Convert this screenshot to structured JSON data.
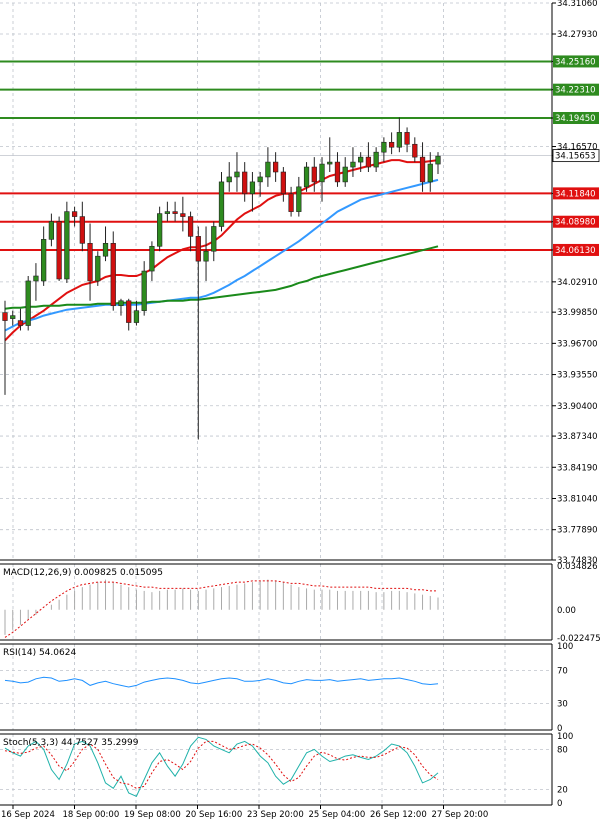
{
  "chart_data": {
    "type": "candlestick",
    "instrument_note": "",
    "y_axis_ticks": [
      "34.31060",
      "34.27930",
      "34.25160",
      "34.22310",
      "34.19450",
      "34.16570",
      "34.15653",
      "34.11840",
      "34.08980",
      "34.06130",
      "34.02910",
      "33.99850",
      "33.96700",
      "33.93550",
      "33.90400",
      "33.87340",
      "33.84190",
      "33.81040",
      "33.77890",
      "33.74830"
    ],
    "ylim": [
      33.7483,
      34.3106
    ],
    "current_price": "34.15653",
    "x_axis_labels": [
      "16 Sep 2024",
      "18 Sep 00:00",
      "19 Sep 08:00",
      "20 Sep 16:00",
      "23 Sep 20:00",
      "25 Sep 04:00",
      "26 Sep 12:00",
      "27 Sep 20:00"
    ],
    "levels": [
      {
        "value": 34.2516,
        "label": "34.25160",
        "color": "#2e8b1f"
      },
      {
        "value": 34.2231,
        "label": "34.22310",
        "color": "#2e8b1f"
      },
      {
        "value": 34.1945,
        "label": "34.19450",
        "color": "#2e8b1f"
      },
      {
        "value": 34.1184,
        "label": "34.11840",
        "color": "#e01010"
      },
      {
        "value": 34.0898,
        "label": "34.08980",
        "color": "#e01010"
      },
      {
        "value": 34.0613,
        "label": "34.06130",
        "color": "#e01010"
      }
    ],
    "candles": [
      {
        "o": 33.998,
        "h": 34.01,
        "l": 33.915,
        "c": 33.99
      },
      {
        "o": 33.992,
        "h": 34.0,
        "l": 33.985,
        "c": 33.995
      },
      {
        "o": 33.99,
        "h": 34.002,
        "l": 33.98,
        "c": 33.985
      },
      {
        "o": 33.985,
        "h": 34.035,
        "l": 33.98,
        "c": 34.03
      },
      {
        "o": 34.03,
        "h": 34.048,
        "l": 34.01,
        "c": 34.035
      },
      {
        "o": 34.03,
        "h": 34.085,
        "l": 34.025,
        "c": 34.072
      },
      {
        "o": 34.072,
        "h": 34.098,
        "l": 34.065,
        "c": 34.09
      },
      {
        "o": 34.09,
        "h": 34.095,
        "l": 34.03,
        "c": 34.032
      },
      {
        "o": 34.032,
        "h": 34.11,
        "l": 34.028,
        "c": 34.1
      },
      {
        "o": 34.1,
        "h": 34.105,
        "l": 34.085,
        "c": 34.095
      },
      {
        "o": 34.095,
        "h": 34.11,
        "l": 34.06,
        "c": 34.068
      },
      {
        "o": 34.068,
        "h": 34.088,
        "l": 34.01,
        "c": 34.03
      },
      {
        "o": 34.03,
        "h": 34.06,
        "l": 34.025,
        "c": 34.055
      },
      {
        "o": 34.055,
        "h": 34.085,
        "l": 34.05,
        "c": 34.068
      },
      {
        "o": 34.068,
        "h": 34.08,
        "l": 34.0,
        "c": 34.005
      },
      {
        "o": 34.005,
        "h": 34.012,
        "l": 33.995,
        "c": 34.01
      },
      {
        "o": 34.01,
        "h": 34.012,
        "l": 33.98,
        "c": 33.988
      },
      {
        "o": 33.988,
        "h": 34.01,
        "l": 33.985,
        "c": 34.0
      },
      {
        "o": 34.0,
        "h": 34.05,
        "l": 33.995,
        "c": 34.04
      },
      {
        "o": 34.04,
        "h": 34.07,
        "l": 34.03,
        "c": 34.065
      },
      {
        "o": 34.065,
        "h": 34.105,
        "l": 34.06,
        "c": 34.098
      },
      {
        "o": 34.098,
        "h": 34.11,
        "l": 34.09,
        "c": 34.1
      },
      {
        "o": 34.1,
        "h": 34.11,
        "l": 34.09,
        "c": 34.098
      },
      {
        "o": 34.098,
        "h": 34.115,
        "l": 34.08,
        "c": 34.095
      },
      {
        "o": 34.095,
        "h": 34.1,
        "l": 34.06,
        "c": 34.075
      },
      {
        "o": 34.075,
        "h": 34.085,
        "l": 33.87,
        "c": 34.05
      },
      {
        "o": 34.05,
        "h": 34.085,
        "l": 34.03,
        "c": 34.06
      },
      {
        "o": 34.06,
        "h": 34.09,
        "l": 34.05,
        "c": 34.085
      },
      {
        "o": 34.085,
        "h": 34.14,
        "l": 34.08,
        "c": 34.13
      },
      {
        "o": 34.13,
        "h": 34.15,
        "l": 34.12,
        "c": 34.135
      },
      {
        "o": 34.135,
        "h": 34.16,
        "l": 34.12,
        "c": 34.14
      },
      {
        "o": 34.14,
        "h": 34.15,
        "l": 34.11,
        "c": 34.118
      },
      {
        "o": 34.118,
        "h": 34.14,
        "l": 34.1,
        "c": 34.13
      },
      {
        "o": 34.13,
        "h": 34.14,
        "l": 34.115,
        "c": 34.135
      },
      {
        "o": 34.135,
        "h": 34.165,
        "l": 34.125,
        "c": 34.15
      },
      {
        "o": 34.15,
        "h": 34.16,
        "l": 34.13,
        "c": 34.14
      },
      {
        "o": 34.14,
        "h": 34.145,
        "l": 34.11,
        "c": 34.118
      },
      {
        "o": 34.118,
        "h": 34.125,
        "l": 34.095,
        "c": 34.1
      },
      {
        "o": 34.1,
        "h": 34.135,
        "l": 34.095,
        "c": 34.125
      },
      {
        "o": 34.125,
        "h": 34.15,
        "l": 34.12,
        "c": 34.145
      },
      {
        "o": 34.145,
        "h": 34.155,
        "l": 34.12,
        "c": 34.13
      },
      {
        "o": 34.13,
        "h": 34.155,
        "l": 34.11,
        "c": 34.148
      },
      {
        "o": 34.148,
        "h": 34.175,
        "l": 34.14,
        "c": 34.15
      },
      {
        "o": 34.15,
        "h": 34.16,
        "l": 34.125,
        "c": 34.13
      },
      {
        "o": 34.13,
        "h": 34.155,
        "l": 34.125,
        "c": 34.145
      },
      {
        "o": 34.145,
        "h": 34.165,
        "l": 34.135,
        "c": 34.15
      },
      {
        "o": 34.15,
        "h": 34.16,
        "l": 34.14,
        "c": 34.155
      },
      {
        "o": 34.155,
        "h": 34.17,
        "l": 34.14,
        "c": 34.145
      },
      {
        "o": 34.145,
        "h": 34.165,
        "l": 34.14,
        "c": 34.16
      },
      {
        "o": 34.16,
        "h": 34.175,
        "l": 34.15,
        "c": 34.17
      },
      {
        "o": 34.17,
        "h": 34.18,
        "l": 34.158,
        "c": 34.165
      },
      {
        "o": 34.165,
        "h": 34.195,
        "l": 34.16,
        "c": 34.18
      },
      {
        "o": 34.18,
        "h": 34.185,
        "l": 34.16,
        "c": 34.168
      },
      {
        "o": 34.168,
        "h": 34.175,
        "l": 34.15,
        "c": 34.155
      },
      {
        "o": 34.155,
        "h": 34.17,
        "l": 34.12,
        "c": 34.13
      },
      {
        "o": 34.13,
        "h": 34.16,
        "l": 34.12,
        "c": 34.148
      },
      {
        "o": 34.148,
        "h": 34.16,
        "l": 34.138,
        "c": 34.156
      }
    ],
    "moving_averages": [
      {
        "color": "#e01010",
        "values": [
          33.97,
          33.978,
          33.985,
          33.99,
          33.995,
          34.0,
          34.006,
          34.012,
          34.018,
          34.022,
          34.026,
          34.028,
          34.03,
          34.034,
          34.036,
          34.036,
          34.035,
          34.035,
          34.038,
          34.042,
          34.048,
          34.054,
          34.058,
          34.062,
          34.064,
          34.064,
          34.066,
          34.07,
          34.076,
          34.084,
          34.092,
          34.098,
          34.102,
          34.106,
          34.112,
          34.116,
          34.118,
          34.118,
          34.12,
          34.124,
          34.128,
          34.132,
          34.136,
          34.138,
          34.14,
          34.142,
          34.144,
          34.146,
          34.148,
          34.15,
          34.152,
          34.152,
          34.15,
          34.15,
          34.15,
          34.151,
          34.152
        ]
      },
      {
        "color": "#3399ff",
        "values": [
          33.98,
          33.984,
          33.988,
          33.99,
          33.992,
          33.995,
          33.997,
          33.999,
          34.001,
          34.002,
          34.003,
          34.004,
          34.005,
          34.006,
          34.006,
          34.006,
          34.006,
          34.006,
          34.007,
          34.008,
          34.009,
          34.01,
          34.011,
          34.012,
          34.013,
          34.013,
          34.015,
          34.018,
          34.022,
          34.026,
          34.031,
          34.035,
          34.04,
          34.045,
          34.05,
          34.055,
          34.06,
          34.065,
          34.07,
          34.076,
          34.082,
          34.088,
          34.094,
          34.1,
          34.104,
          34.108,
          34.112,
          34.114,
          34.116,
          34.118,
          34.12,
          34.122,
          34.124,
          34.126,
          34.128,
          34.13,
          34.132
        ]
      },
      {
        "color": "#1a8a1a",
        "values": [
          34.002,
          34.003,
          34.003,
          34.004,
          34.004,
          34.005,
          34.005,
          34.005,
          34.006,
          34.006,
          34.006,
          34.006,
          34.007,
          34.007,
          34.007,
          34.008,
          34.008,
          34.008,
          34.008,
          34.009,
          34.009,
          34.01,
          34.01,
          34.01,
          34.011,
          34.011,
          34.012,
          34.013,
          34.014,
          34.015,
          34.016,
          34.017,
          34.018,
          34.019,
          34.02,
          34.021,
          34.023,
          34.025,
          34.028,
          34.03,
          34.033,
          34.035,
          34.037,
          34.039,
          34.041,
          34.043,
          34.045,
          34.047,
          34.049,
          34.051,
          34.053,
          34.055,
          34.057,
          34.059,
          34.061,
          34.063,
          34.065
        ]
      }
    ],
    "macd": {
      "label": "MACD(12,26,9) 0.009825 0.015095",
      "ticks": [
        "0.034826",
        "0.00",
        "-0.022475"
      ],
      "ylim": [
        -0.022475,
        0.034826
      ],
      "histogram": [
        -0.02,
        -0.016,
        -0.012,
        -0.008,
        -0.004,
        0.0,
        0.004,
        0.008,
        0.012,
        0.015,
        0.018,
        0.02,
        0.022,
        0.024,
        0.022,
        0.02,
        0.018,
        0.016,
        0.015,
        0.014,
        0.015,
        0.016,
        0.016,
        0.017,
        0.016,
        0.015,
        0.016,
        0.017,
        0.018,
        0.019,
        0.02,
        0.021,
        0.022,
        0.023,
        0.024,
        0.023,
        0.022,
        0.02,
        0.018,
        0.017,
        0.016,
        0.016,
        0.016,
        0.015,
        0.015,
        0.015,
        0.015,
        0.015,
        0.014,
        0.014,
        0.015,
        0.015,
        0.014,
        0.013,
        0.012,
        0.011,
        0.0098
      ],
      "signal": [
        -0.022,
        -0.018,
        -0.013,
        -0.008,
        -0.003,
        0.002,
        0.007,
        0.011,
        0.015,
        0.018,
        0.02,
        0.021,
        0.022,
        0.022,
        0.022,
        0.021,
        0.02,
        0.019,
        0.018,
        0.018,
        0.017,
        0.017,
        0.017,
        0.017,
        0.017,
        0.017,
        0.018,
        0.019,
        0.02,
        0.021,
        0.022,
        0.022,
        0.023,
        0.023,
        0.023,
        0.023,
        0.022,
        0.021,
        0.021,
        0.02,
        0.019,
        0.019,
        0.018,
        0.018,
        0.018,
        0.018,
        0.018,
        0.018,
        0.017,
        0.017,
        0.017,
        0.017,
        0.017,
        0.016,
        0.016,
        0.015,
        0.0151
      ]
    },
    "rsi": {
      "label": "RSI(14) 54.0624",
      "ticks": [
        "100",
        "70",
        "30",
        "0"
      ],
      "ylim": [
        0,
        100
      ],
      "values": [
        58,
        57,
        55,
        56,
        60,
        62,
        61,
        57,
        58,
        60,
        58,
        52,
        55,
        57,
        54,
        52,
        50,
        52,
        56,
        58,
        60,
        61,
        60,
        58,
        55,
        54,
        56,
        58,
        60,
        61,
        60,
        57,
        57,
        58,
        60,
        58,
        55,
        54,
        57,
        59,
        58,
        58,
        59,
        57,
        58,
        59,
        60,
        58,
        59,
        60,
        60,
        61,
        59,
        57,
        54,
        53,
        54
      ]
    },
    "stoch": {
      "label": "Stoch(5,3,3) 44.7527 35.2999",
      "ticks": [
        "100",
        "80",
        "20",
        "0"
      ],
      "ylim": [
        0,
        100
      ],
      "k": [
        82,
        75,
        70,
        85,
        92,
        80,
        50,
        35,
        58,
        88,
        92,
        85,
        60,
        30,
        22,
        40,
        15,
        10,
        35,
        60,
        75,
        55,
        40,
        58,
        85,
        98,
        95,
        85,
        80,
        75,
        88,
        92,
        85,
        70,
        60,
        40,
        28,
        35,
        55,
        75,
        80,
        70,
        62,
        65,
        70,
        72,
        68,
        65,
        70,
        78,
        88,
        85,
        75,
        55,
        30,
        35,
        45
      ],
      "d": [
        78,
        76,
        74,
        76,
        82,
        85,
        72,
        55,
        48,
        62,
        80,
        88,
        80,
        58,
        38,
        30,
        28,
        22,
        25,
        45,
        62,
        65,
        58,
        50,
        62,
        82,
        92,
        92,
        86,
        80,
        82,
        86,
        88,
        82,
        72,
        58,
        42,
        32,
        38,
        55,
        70,
        76,
        72,
        66,
        64,
        68,
        70,
        68,
        68,
        72,
        78,
        84,
        82,
        72,
        55,
        42,
        35
      ]
    }
  }
}
